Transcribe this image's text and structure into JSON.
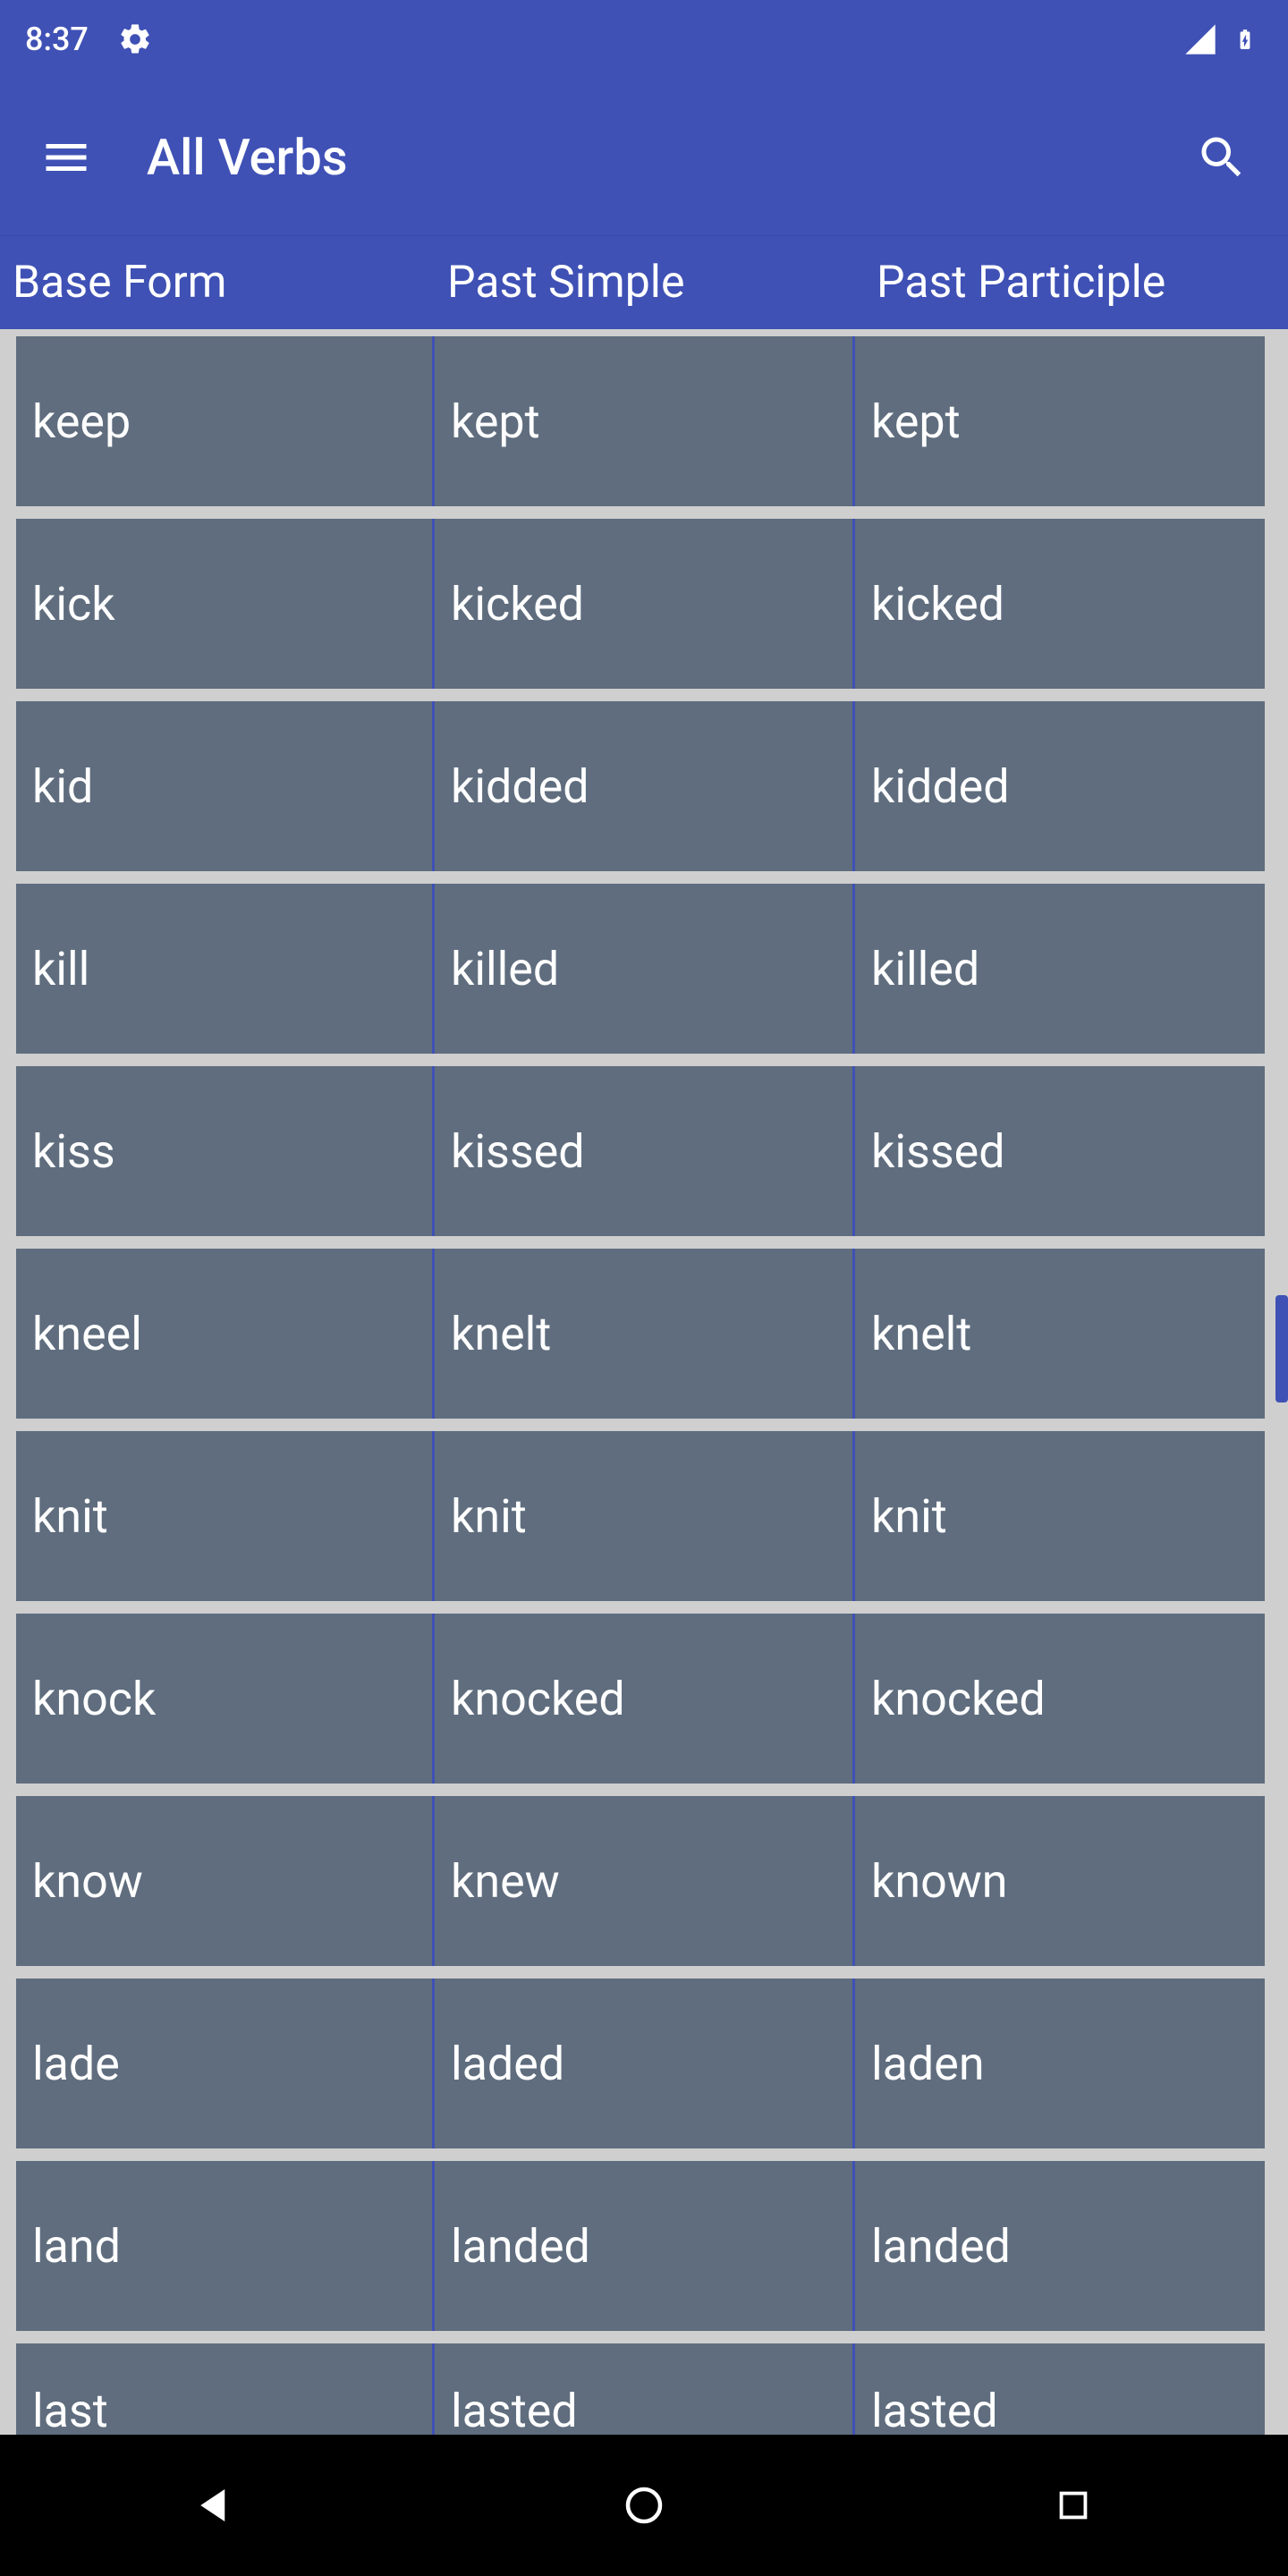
{
  "status_bar": {
    "time": "8:37"
  },
  "app_bar": {
    "title": "All Verbs"
  },
  "columns": {
    "c1": "Base Form",
    "c2": "Past Simple",
    "c3": "Past Participle"
  },
  "verbs": [
    {
      "base": "keep",
      "past": "kept",
      "pp": "kept"
    },
    {
      "base": "kick",
      "past": "kicked",
      "pp": "kicked"
    },
    {
      "base": "kid",
      "past": "kidded",
      "pp": "kidded"
    },
    {
      "base": "kill",
      "past": "killed",
      "pp": "killed"
    },
    {
      "base": "kiss",
      "past": "kissed",
      "pp": "kissed"
    },
    {
      "base": "kneel",
      "past": "knelt",
      "pp": "knelt"
    },
    {
      "base": "knit",
      "past": "knit",
      "pp": "knit"
    },
    {
      "base": "knock",
      "past": "knocked",
      "pp": "knocked"
    },
    {
      "base": "know",
      "past": "knew",
      "pp": "known"
    },
    {
      "base": "lade",
      "past": "laded",
      "pp": "laden"
    },
    {
      "base": "land",
      "past": "landed",
      "pp": "landed"
    },
    {
      "base": "last",
      "past": "lasted",
      "pp": "lasted"
    }
  ]
}
